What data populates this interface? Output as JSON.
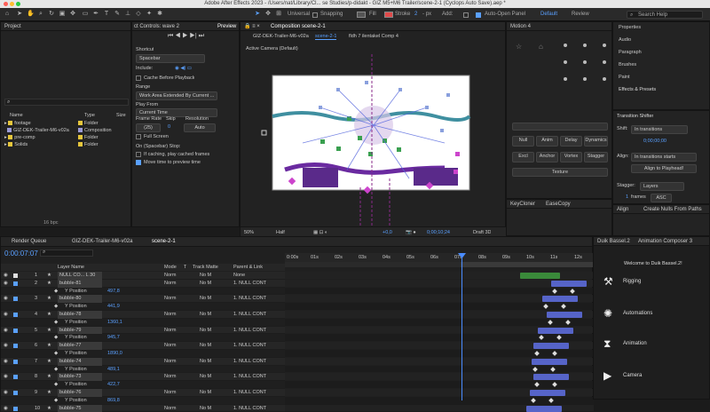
{
  "window": {
    "title": "Adobe After Effects 2023 - /Users/nat/Library/Cl... se Studies/p-didakt - GIZ M5+M6 Trailer/scene-2-1 (Cyclops Auto Save).aep *"
  },
  "toolbar": {
    "universal": "Universal",
    "snapping": "Snapping",
    "fill": "Fill",
    "stroke": "Stroke",
    "stroke_value": "2",
    "px": "- px",
    "add": "Add:",
    "auto_open": "Auto-Open Panel",
    "workspace_default": "Default",
    "workspace_review": "Review",
    "search_placeholder": "Search Help"
  },
  "project_panel": {
    "title": "Project",
    "columns": [
      "Name",
      "Type",
      "Size"
    ],
    "items": [
      {
        "name": "footage",
        "type": "Folder",
        "color": "#e6c63c"
      },
      {
        "name": "GIZ-DEK-Trailer-M6-v02a",
        "type": "Composition",
        "color": "#9a9ad6"
      },
      {
        "name": "pre-comp",
        "type": "Folder",
        "color": "#e6c63c"
      },
      {
        "name": "Solids",
        "type": "Folder",
        "color": "#e6c63c"
      }
    ],
    "bpc": "16 bpc"
  },
  "preview_panel": {
    "tab_effect": "ct Controls: wave 2",
    "tab_preview": "Preview",
    "shortcut_label": "Shortcut",
    "shortcut_value": "Spacebar",
    "include_label": "Include:",
    "cache_label": "Cache Before Playback",
    "range_label": "Range",
    "range_value": "Work Area Extended By Current ...",
    "play_from_label": "Play From",
    "play_from_value": "Current Time",
    "frame_rate_label": "Frame Rate",
    "skip_label": "Skip",
    "resolution_label": "Resolution",
    "frame_rate_value": "(25)",
    "skip_value": "0",
    "resolution_value": "Auto",
    "full_screen": "Full Screen",
    "on_stop": "On (Spacebar) Stop:",
    "if_caching": "If caching, play cached frames",
    "move_time": "Move time to preview time"
  },
  "composition_panel": {
    "tab": "Composition scene-2-1",
    "crumbs": [
      "GIZ-DEK-Trailer-M6-v02a",
      "scene-2-1",
      "fldh 7 ilentakel Comp 4"
    ],
    "camera_label": "Active Camera (Default)",
    "zoom": "50%",
    "quality": "Half",
    "timecode": "0;00;10;24",
    "exposure": "+0,0",
    "renderer": "Draft 3D"
  },
  "motion_panel": {
    "title": "Motion 4",
    "buttons": [
      "Null",
      "Anim",
      "Delay",
      "Dynamics",
      "Excl",
      "Anchor",
      "Vortex",
      "Stagger",
      "Texture"
    ]
  },
  "right_panel": {
    "items": [
      "Properties",
      "Audio",
      "Paragraph",
      "Brushes",
      "Paint",
      "Effects & Presets"
    ]
  },
  "transition_shifter": {
    "title": "Transition Shifter",
    "shift_label": "Shift:",
    "shift_value": "In transitions",
    "time_value": "0;00;00;00",
    "align_label": "Align:",
    "align_value": "In transitions starts",
    "align_button": "Align to Playhead!",
    "stagger_label": "Stagger:",
    "stagger_value": "Layers",
    "frames_value": "1",
    "frames_label": "frames",
    "order_value": "ASC"
  },
  "keycloner": {
    "tab1": "KeyCloner",
    "tab2": "EaseCopy"
  },
  "align_panel": {
    "tab1": "Align",
    "tab2": "Create Nulls From Paths"
  },
  "timeline": {
    "tabs": [
      "Render Queue",
      "GIZ-DEK-Trailer-M6-v02a",
      "scene-2-1"
    ],
    "current_time": "0:00:07:07",
    "columns": [
      "Layer Name",
      "Mode",
      "T",
      "Track Matte",
      "Parent & Link"
    ],
    "ruler": [
      "0:00s",
      "01s",
      "02s",
      "03s",
      "04s",
      "05s",
      "06s",
      "07s",
      "08s",
      "09s",
      "10s",
      "11s",
      "12s"
    ],
    "layers": [
      {
        "num": "1",
        "name": "NULL CO... L 30",
        "mode": "Norm",
        "matte": "No M",
        "parent": "None",
        "color": "#e0e0e0",
        "sub": false
      },
      {
        "num": "2",
        "name": "bubble-81",
        "mode": "Norm",
        "matte": "No M",
        "parent": "1. NULL CONT",
        "color": "#5aa0ff",
        "sub": false
      },
      {
        "num": "",
        "name": "Y Position",
        "value": "497,8",
        "sub": true
      },
      {
        "num": "3",
        "name": "bubble-80",
        "mode": "Norm",
        "matte": "No M",
        "parent": "1. NULL CONT",
        "color": "#5aa0ff",
        "sub": false
      },
      {
        "num": "",
        "name": "Y Position",
        "value": "441,9",
        "sub": true
      },
      {
        "num": "4",
        "name": "bubble-78",
        "mode": "Norm",
        "matte": "No M",
        "parent": "1. NULL CONT",
        "color": "#5aa0ff",
        "sub": false
      },
      {
        "num": "",
        "name": "Y Position",
        "value": "1360,1",
        "sub": true
      },
      {
        "num": "5",
        "name": "bubble-79",
        "mode": "Norm",
        "matte": "No M",
        "parent": "1. NULL CONT",
        "color": "#5aa0ff",
        "sub": false
      },
      {
        "num": "",
        "name": "Y Position",
        "value": "945,7",
        "sub": true
      },
      {
        "num": "6",
        "name": "bubble-77",
        "mode": "Norm",
        "matte": "No M",
        "parent": "1. NULL CONT",
        "color": "#5aa0ff",
        "sub": false
      },
      {
        "num": "",
        "name": "Y Position",
        "value": "1890,0",
        "sub": true
      },
      {
        "num": "7",
        "name": "bubble-74",
        "mode": "Norm",
        "matte": "No M",
        "parent": "1. NULL CONT",
        "color": "#5aa0ff",
        "sub": false
      },
      {
        "num": "",
        "name": "Y Position",
        "value": "489,1",
        "sub": true
      },
      {
        "num": "8",
        "name": "bubble-73",
        "mode": "Norm",
        "matte": "No M",
        "parent": "1. NULL CONT",
        "color": "#5aa0ff",
        "sub": false
      },
      {
        "num": "",
        "name": "Y Position",
        "value": "422,7",
        "sub": true
      },
      {
        "num": "9",
        "name": "bubble-76",
        "mode": "Norm",
        "matte": "No M",
        "parent": "1. NULL CONT",
        "color": "#5aa0ff",
        "sub": false
      },
      {
        "num": "",
        "name": "Y Position",
        "value": "869,8",
        "sub": true
      },
      {
        "num": "10",
        "name": "bubble-75",
        "mode": "Norm",
        "matte": "No M",
        "parent": "1. NULL CONT",
        "color": "#5aa0ff",
        "sub": false
      }
    ]
  },
  "duik": {
    "tab1": "Duik Bassel.2",
    "tab2": "Animation Composer 3",
    "welcome": "Welcome to Duik Bassel.2!",
    "items": [
      "Rigging",
      "Automations",
      "Animation",
      "Camera"
    ]
  }
}
